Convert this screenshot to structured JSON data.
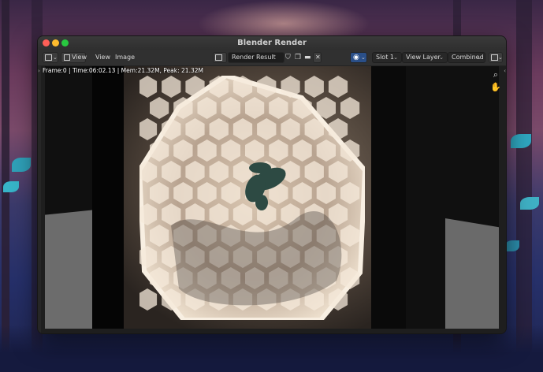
{
  "window": {
    "title": "Blender Render"
  },
  "toolbar": {
    "editor_type_icon": "image-editor-icon",
    "menus": [
      "View",
      "View",
      "Image"
    ],
    "image_browse_icon": "image-browse-icon",
    "image_name": "Render Result",
    "shield_icon": "fake-user-shield-icon",
    "new_icon": "new-image-icon",
    "open_icon": "folder-open-icon",
    "close_icon": "close-icon",
    "render_icon": "render-slot-icon",
    "slot": "Slot 1",
    "view_layer": "View Layer",
    "pass": "Combined",
    "display_icon": "display-channels-icon"
  },
  "status": {
    "text": "Frame:0 | Time:06:02.13 | Mem:21.32M, Peak: 21.32M"
  },
  "tools": {
    "zoom_icon": "magnifier-icon",
    "pan_icon": "hand-icon"
  },
  "colors": {
    "window_bg": "#2b2b2b",
    "toolbar_bg": "#303030",
    "viewport_bg": "#1e1e1e",
    "traffic_close": "#fe5f57",
    "traffic_min": "#febc2e",
    "traffic_max": "#28c840"
  }
}
